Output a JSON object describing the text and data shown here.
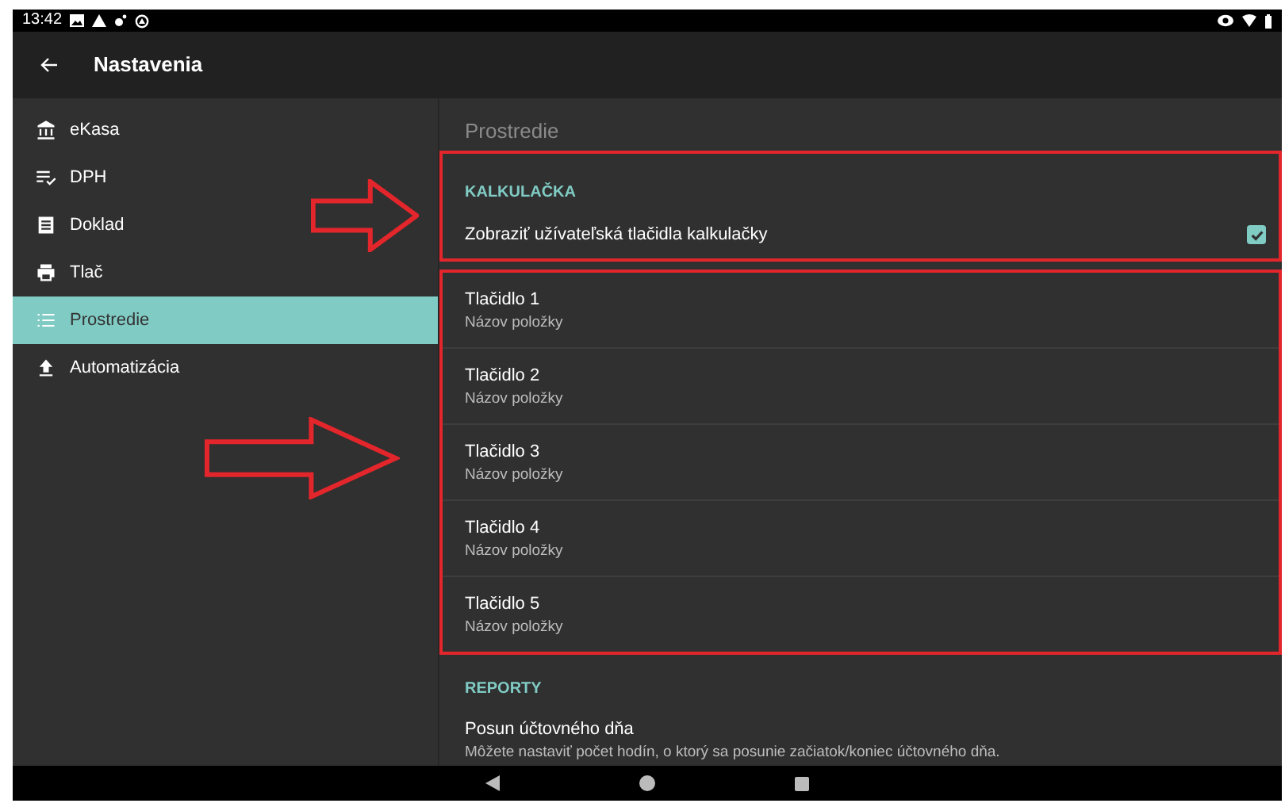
{
  "status_bar": {
    "time": "13:42"
  },
  "app_bar": {
    "title": "Nastavenia"
  },
  "sidebar": {
    "items": [
      {
        "label": "eKasa",
        "selected": false
      },
      {
        "label": "DPH",
        "selected": false
      },
      {
        "label": "Doklad",
        "selected": false
      },
      {
        "label": "Tlač",
        "selected": false
      },
      {
        "label": "Prostredie",
        "selected": true
      },
      {
        "label": "Automatizácia",
        "selected": false
      }
    ]
  },
  "page_title": "Prostredie",
  "calculator": {
    "header": "KALKULAČKA",
    "toggle": {
      "label": "Zobraziť užívateľská tlačidla kalkulačky",
      "checked": true
    },
    "buttons": [
      {
        "title": "Tlačidlo 1",
        "subtitle": "Názov položky"
      },
      {
        "title": "Tlačidlo 2",
        "subtitle": "Názov položky"
      },
      {
        "title": "Tlačidlo 3",
        "subtitle": "Názov položky"
      },
      {
        "title": "Tlačidlo 4",
        "subtitle": "Názov položky"
      },
      {
        "title": "Tlačidlo 5",
        "subtitle": "Názov položky"
      }
    ]
  },
  "reports": {
    "header": "REPORTY",
    "items": [
      {
        "title": "Posun účtovného dňa",
        "subtitle": "Môžete nastaviť počet hodín, o ktorý sa posunie začiatok/koniec účtovného dňa."
      }
    ]
  }
}
